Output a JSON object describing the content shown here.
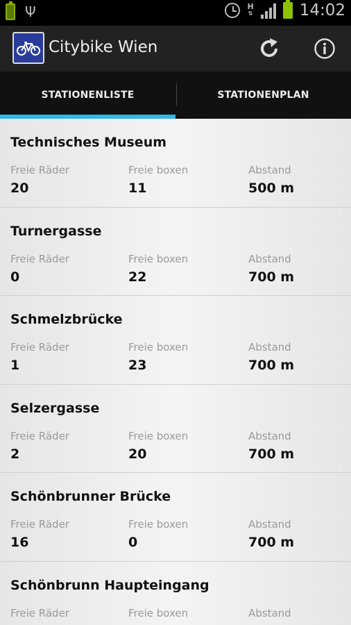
{
  "status_bar": {
    "time": "14:02",
    "network": "H",
    "icons": [
      "battery-charging-icon",
      "usb-icon",
      "alarm-icon",
      "network-h-icon",
      "signal-icon",
      "battery-icon"
    ]
  },
  "app": {
    "title": "Citybike Wien",
    "icon": "bicycle-icon",
    "accent": "#33b5e5"
  },
  "actions": {
    "refresh_icon": "refresh-icon",
    "info_icon": "info-icon"
  },
  "tabs": [
    {
      "label": "STATIONENLISTE",
      "active": true
    },
    {
      "label": "STATIONENPLAN",
      "active": false
    }
  ],
  "labels": {
    "bikes": "Freie Räder",
    "boxes": "Freie boxen",
    "distance": "Abstand"
  },
  "stations": [
    {
      "name": "Technisches Museum",
      "bikes": "20",
      "boxes": "11",
      "distance": "500 m"
    },
    {
      "name": "Turnergasse",
      "bikes": "0",
      "boxes": "22",
      "distance": "700 m"
    },
    {
      "name": "Schmelzbrücke",
      "bikes": "1",
      "boxes": "23",
      "distance": "700 m"
    },
    {
      "name": "Selzergasse",
      "bikes": "2",
      "boxes": "20",
      "distance": "700 m"
    },
    {
      "name": "Schönbrunner Brücke",
      "bikes": "16",
      "boxes": "0",
      "distance": "700 m"
    },
    {
      "name": "Schönbrunn Haupteingang",
      "bikes": "",
      "boxes": "",
      "distance": ""
    }
  ]
}
